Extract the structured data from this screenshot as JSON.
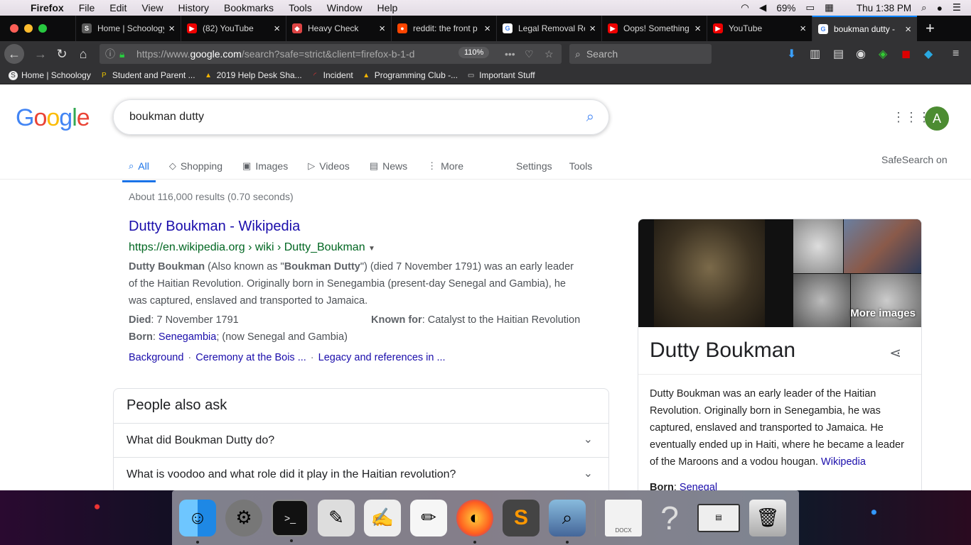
{
  "menubar": {
    "apple": "",
    "app": "Firefox",
    "items": [
      "File",
      "Edit",
      "View",
      "History",
      "Bookmarks",
      "Tools",
      "Window",
      "Help"
    ],
    "battery": "69%",
    "time": "Thu 1:38 PM"
  },
  "tabs": [
    {
      "title": "Home | Schoology",
      "color": "#5b5b5b",
      "glyph": "S"
    },
    {
      "title": "(82) YouTube",
      "color": "#e00",
      "glyph": "▶"
    },
    {
      "title": "Heavy Check",
      "color": "#d44",
      "glyph": "◆"
    },
    {
      "title": "reddit: the front p",
      "color": "#ff4500",
      "glyph": "●"
    },
    {
      "title": "Legal Removal Re",
      "color": "#fff",
      "glyph": "G"
    },
    {
      "title": "Oops! Something",
      "color": "#e00",
      "glyph": "▶"
    },
    {
      "title": "YouTube",
      "color": "#e00",
      "glyph": "▶"
    },
    {
      "title": "boukman dutty -",
      "color": "#fff",
      "glyph": "G",
      "active": true
    }
  ],
  "nav": {
    "url_prefix": "https://www.",
    "url_domain": "google.com",
    "url_rest": "/search?safe=strict&client=firefox-b-1-d",
    "zoom": "110%",
    "search_placeholder": "Search"
  },
  "bookmarks": [
    "Home | Schoology",
    "Student and Parent ...",
    "2019 Help Desk Sha...",
    "Incident",
    "Programming Club -...",
    "Important Stuff"
  ],
  "google": {
    "query": "boukman dutty",
    "tabs": [
      "All",
      "Shopping",
      "Images",
      "Videos",
      "News",
      "More"
    ],
    "settings": "Settings",
    "tools": "Tools",
    "safesearch": "SafeSearch on",
    "avatar": "A",
    "stats": "About 116,000 results (0.70 seconds)"
  },
  "result": {
    "title": "Dutty Boukman - Wikipedia",
    "url": "https://en.wikipedia.org › wiki › Dutty_Boukman",
    "snippet_b1": "Dutty Boukman",
    "snippet_t1": " (Also known as \"",
    "snippet_b2": "Boukman Dutty",
    "snippet_t2": "\") (died 7 November 1791) was an early leader of the Haitian Revolution. Originally born in Senegambia (present-day Senegal and Gambia), he was captured, enslaved and transported to Jamaica.",
    "died_label": "Died",
    "died_value": ": 7 November 1791",
    "known_label": "Known for",
    "known_value": ": Catalyst to the Haitian Revolution",
    "born_label": "Born",
    "born_link": "Senegambia",
    "born_rest": "; (now Senegal and Gambia)",
    "sitelinks": [
      "Background",
      "Ceremony at the Bois ...",
      "Legacy and references in ..."
    ]
  },
  "paa": {
    "heading": "People also ask",
    "questions": [
      "What did Boukman Dutty do?",
      "What is voodoo and what role did it play in the Haitian revolution?"
    ]
  },
  "kp": {
    "more_images": "More images",
    "title": "Dutty Boukman",
    "description": "Dutty Boukman was an early leader of the Haitian Revolution. Originally born in Senegambia, he was captured, enslaved and transported to Jamaica. He eventually ended up in Haiti, where he became a leader of the Maroons and a vodou hougan.",
    "source": "Wikipedia",
    "born_label": "Born",
    "born_value": "Senegal"
  },
  "dock": [
    "finder",
    "system-preferences",
    "terminal",
    "script-editor",
    "textedit",
    "notes",
    "firefox",
    "sublime-text",
    "preview",
    "docx-file",
    "help",
    "screenshot",
    "trash"
  ],
  "dock_labels": {
    "docx": "DOCX"
  }
}
